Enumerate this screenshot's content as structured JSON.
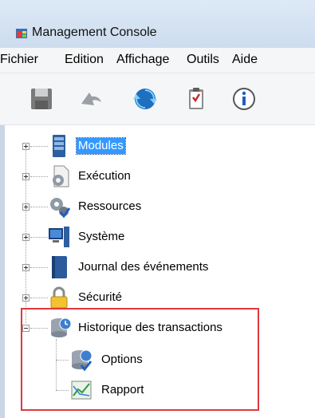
{
  "window": {
    "title": "Management Console"
  },
  "menu": [
    "Fichier",
    "Edition",
    "Affichage",
    "Outils",
    "Aide"
  ],
  "toolbar": [
    {
      "name": "save-icon"
    },
    {
      "name": "undo-icon"
    },
    {
      "name": "refresh-icon"
    },
    {
      "name": "clipboard-icon"
    },
    {
      "name": "info-icon"
    }
  ],
  "tree": [
    {
      "label": "Modules",
      "icon": "server-icon",
      "expander": "plus",
      "selected": true
    },
    {
      "label": "Exécution",
      "icon": "gear-document-icon",
      "expander": "plus",
      "selected": false
    },
    {
      "label": "Ressources",
      "icon": "gears-check-icon",
      "expander": "plus",
      "selected": false
    },
    {
      "label": "Système",
      "icon": "computer-icon",
      "expander": "plus",
      "selected": false
    },
    {
      "label": "Journal des événements",
      "icon": "book-icon",
      "expander": "plus",
      "selected": false
    },
    {
      "label": "Sécurité",
      "icon": "padlock-icon",
      "expander": "plus",
      "selected": false
    },
    {
      "label": "Historique des transactions",
      "icon": "database-clock-icon",
      "expander": "minus",
      "selected": false,
      "children": [
        {
          "label": "Options",
          "icon": "database-check-icon"
        },
        {
          "label": "Rapport",
          "icon": "chart-report-icon"
        }
      ]
    }
  ],
  "colors": {
    "selection": "#3399ff",
    "highlight": "#e0383d"
  }
}
